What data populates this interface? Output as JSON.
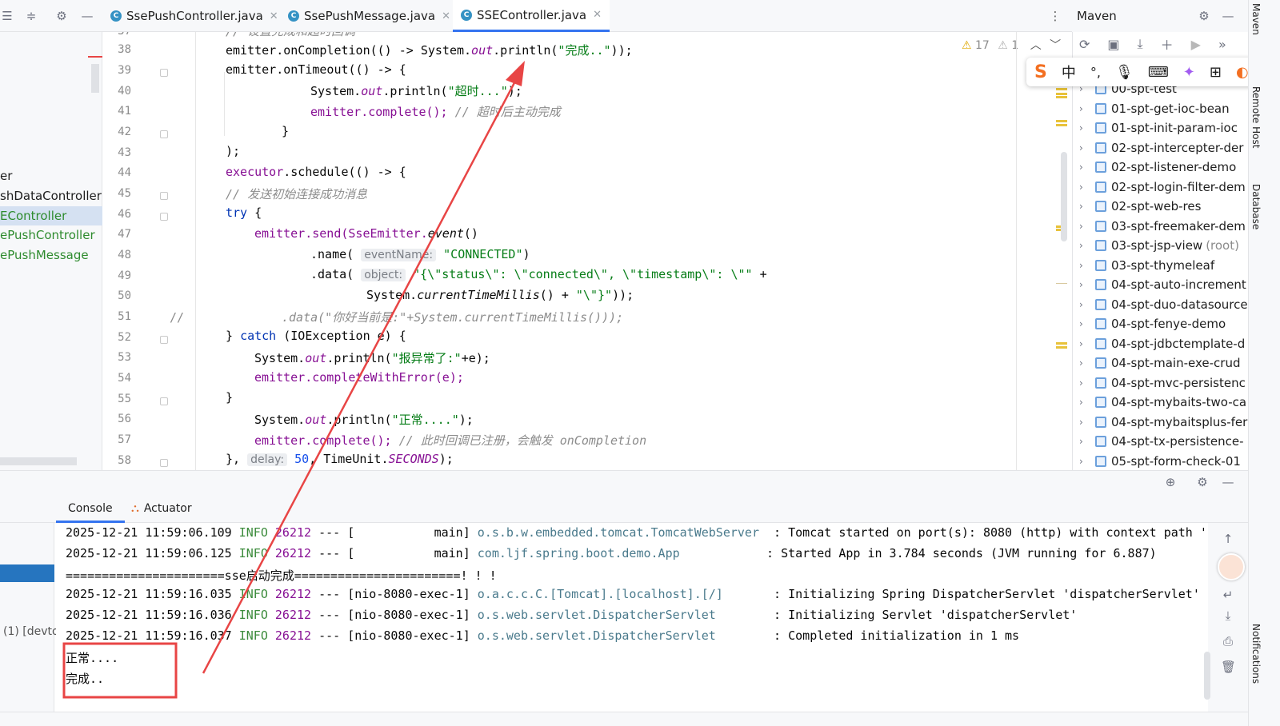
{
  "tabs": [
    {
      "label": "SsePushController.java",
      "active": false
    },
    {
      "label": "SsePushMessage.java",
      "active": false
    },
    {
      "label": "SSEController.java",
      "active": true
    }
  ],
  "maven": {
    "title": "Maven",
    "items": [
      {
        "name": "00-spt-test",
        "extra": ""
      },
      {
        "name": "01-spt-get-ioc-bean",
        "extra": ""
      },
      {
        "name": "01-spt-init-param-ioc",
        "extra": ""
      },
      {
        "name": "02-spt-intercepter-der",
        "extra": ""
      },
      {
        "name": "02-spt-listener-demo",
        "extra": ""
      },
      {
        "name": "02-spt-login-filter-dem",
        "extra": ""
      },
      {
        "name": "02-spt-web-res",
        "extra": ""
      },
      {
        "name": "03-spt-freemaker-dem",
        "extra": ""
      },
      {
        "name": "03-spt-jsp-view",
        "extra": "(root)"
      },
      {
        "name": "03-spt-thymeleaf",
        "extra": ""
      },
      {
        "name": "04-spt-auto-increment",
        "extra": ""
      },
      {
        "name": "04-spt-duo-datasource",
        "extra": ""
      },
      {
        "name": "04-spt-fenye-demo",
        "extra": ""
      },
      {
        "name": "04-spt-jdbctemplate-d",
        "extra": ""
      },
      {
        "name": "04-spt-main-exe-crud",
        "extra": ""
      },
      {
        "name": "04-spt-mvc-persistenc",
        "extra": ""
      },
      {
        "name": "04-spt-mybaits-two-ca",
        "extra": ""
      },
      {
        "name": "04-spt-mybaitsplus-fer",
        "extra": ""
      },
      {
        "name": "04-spt-tx-persistence-",
        "extra": ""
      },
      {
        "name": "05-spt-form-check-01",
        "extra": ""
      }
    ]
  },
  "project": {
    "items": [
      "er",
      "shDataController",
      "EController",
      "ePushController",
      "ePushMessage"
    ]
  },
  "editor": {
    "warnings": "17",
    "weak_warnings": "1",
    "line_numbers": [
      "37",
      "38",
      "39",
      "40",
      "41",
      "42",
      "43",
      "44",
      "45",
      "46",
      "47",
      "48",
      "49",
      "50",
      "51",
      "52",
      "53",
      "54",
      "55",
      "56",
      "57",
      "58"
    ],
    "line51_prefix": "//",
    "code": {
      "l37": "// 设置完成和超时回调",
      "l38a": "emitter.onCompletion(() -> System.",
      "l38b": "out",
      "l38c": ".println(",
      "l38d": "\"完成..\"",
      "l38e": "));",
      "l39": "emitter.onTimeout(() -> {",
      "l40a": "System.",
      "l40b": "out",
      "l40c": ".println(",
      "l40d": "\"超时...\"",
      "l40e": ");",
      "l41a": "emitter.complete(); ",
      "l41b": "// 超时后主动完成",
      "l42": "}",
      "l43": ");",
      "l44a": "executor",
      "l44b": ".schedule(() -> {",
      "l45": "// 发送初始连接成功消息",
      "l46a": "try",
      "l46b": " {",
      "l47a": "emitter.send(SseEmitter.",
      "l47b": "event",
      "l47c": "()",
      "l48a": ".name( ",
      "l48h": "eventName:",
      "l48b": " ",
      "l48c": "\"CONNECTED\"",
      "l48d": ")",
      "l49a": ".data( ",
      "l49h": "object:",
      "l49b": " ",
      "l49c": "\"{\\\"status\\\": \\\"connected\\\", \\\"timestamp\\\": \\\"\"",
      "l49d": " +",
      "l50a": "System.",
      "l50b": "currentTimeMillis",
      "l50c": "() + ",
      "l50d": "\"\\\"}\"",
      "l50e": "));",
      "l51": ".data(\"你好当前是:\"+System.currentTimeMillis()));",
      "l52a": "} ",
      "l52b": "catch",
      "l52c": " (IOException e) {",
      "l53a": "System.",
      "l53b": "out",
      "l53c": ".println(",
      "l53d": "\"报异常了:\"",
      "l53e": "+e);",
      "l54": "emitter.completeWithError(e);",
      "l55": "}",
      "l56a": "System.",
      "l56b": "out",
      "l56c": ".println(",
      "l56d": "\"正常....\"",
      "l56e": ");",
      "l57a": "emitter.complete(); ",
      "l57b": "// 此时回调已注册，会触发 ",
      "l57c": "onCompletion",
      "l58a": "}, ",
      "l58h": "delay:",
      "l58b": " ",
      "l58c": "50",
      "l58d": ", TimeUnit.",
      "l58e": "SECONDS",
      "l58f": ");"
    }
  },
  "ime": {
    "brand": "S",
    "lang": "中"
  },
  "side": {
    "maven": "Maven",
    "remote": "Remote Host",
    "database": "Database",
    "notifications": "Notifications"
  },
  "console": {
    "tabs": [
      "Console",
      "Actuator"
    ],
    "left_label": "(1) [devto",
    "lines": [
      {
        "ts": "2025-12-21 11:59:06.109",
        "level": "INFO",
        "pid": "26212",
        "sep": "---",
        "thread": "[           main]",
        "logger": "o.s.b.w.embedded.tomcat.TomcatWebServer ",
        "msg": ": Tomcat started on port(s): 8080 (http) with context path ''"
      },
      {
        "ts": "2025-12-21 11:59:06.125",
        "level": "INFO",
        "pid": "26212",
        "sep": "---",
        "thread": "[           main]",
        "logger": "com.ljf.spring.boot.demo.App           ",
        "msg": ": Started App in 3.784 seconds (JVM running for 6.887)"
      },
      {
        "text": "======================sse启动完成=======================! ! !"
      },
      {
        "ts": "2025-12-21 11:59:16.035",
        "level": "INFO",
        "pid": "26212",
        "sep": "---",
        "thread": "[nio-8080-exec-1]",
        "logger": "o.a.c.c.C.[Tomcat].[localhost].[/]      ",
        "msg": ": Initializing Spring DispatcherServlet 'dispatcherServlet'"
      },
      {
        "ts": "2025-12-21 11:59:16.036",
        "level": "INFO",
        "pid": "26212",
        "sep": "---",
        "thread": "[nio-8080-exec-1]",
        "logger": "o.s.web.servlet.DispatcherServlet       ",
        "msg": ": Initializing Servlet 'dispatcherServlet'"
      },
      {
        "ts": "2025-12-21 11:59:16.037",
        "level": "INFO",
        "pid": "26212",
        "sep": "---",
        "thread": "[nio-8080-exec-1]",
        "logger": "o.s.web.servlet.DispatcherServlet       ",
        "msg": ": Completed initialization in 1 ms"
      },
      {
        "text": "正常...."
      },
      {
        "text": "完成.."
      }
    ]
  },
  "colors": {
    "annotation": "#e84545",
    "accent": "#3574f0"
  }
}
